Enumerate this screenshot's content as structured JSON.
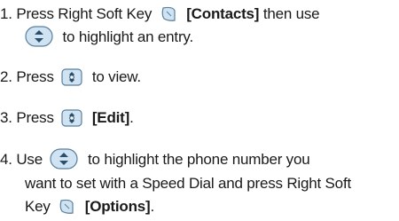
{
  "steps": [
    {
      "num": "1.",
      "lines": [
        {
          "pre": "Press Right Soft Key",
          "bold": "[Contacts]",
          "post": "then use"
        },
        {
          "post": "to highlight an entry."
        }
      ]
    },
    {
      "num": "2.",
      "lines": [
        {
          "pre": "Press",
          "post": "to view."
        }
      ]
    },
    {
      "num": "3.",
      "lines": [
        {
          "pre": "Press",
          "bold": "[Edit]",
          "post": "."
        }
      ]
    },
    {
      "num": "4.",
      "lines": [
        {
          "pre": "Use",
          "post": "to highlight the phone number you"
        },
        {
          "text": "want to set with a Speed Dial and press Right Soft"
        },
        {
          "pre": "Key",
          "bold": "[Options]",
          "post": "."
        }
      ]
    }
  ],
  "icons": {
    "soft_key": "right-soft-key-icon",
    "nav_key": "up-down-navigation-key-icon",
    "ok_key": "ok-center-key-icon"
  },
  "colors": {
    "text": "#1a1a1a",
    "icon_fill": "#cfe3f2",
    "icon_stroke": "#5a7f9e"
  }
}
